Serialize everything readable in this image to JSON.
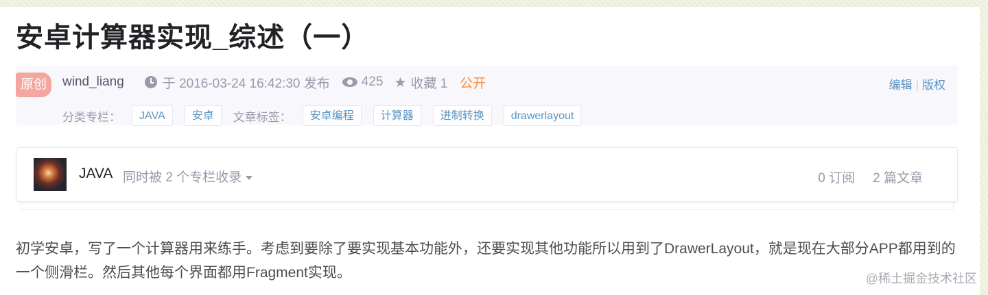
{
  "title": "安卓计算器实现_综述（一）",
  "meta": {
    "badge": "原创",
    "author": "wind_liang",
    "published": "于 2016-03-24 16:42:30 发布",
    "views": "425",
    "favorites": "收藏 1",
    "visibility": "公开",
    "edit_label": "编辑",
    "copyright_label": "版权",
    "category_label": "分类专栏：",
    "categories": [
      "JAVA",
      "安卓"
    ],
    "tags_label": "文章标签：",
    "tags": [
      "安卓编程",
      "计算器",
      "进制转换",
      "drawerlayout"
    ]
  },
  "column": {
    "name": "JAVA",
    "subtitle": "同时被 2 个专栏收录",
    "subscriptions": "0 订阅",
    "articles": "2 篇文章"
  },
  "article": {
    "paragraph": "初学安卓，写了一个计算器用来练手。考虑到要除了要实现基本功能外，还要实现其他功能所以用到了DrawerLayout，就是现在大部分APP都用到的一个侧滑栏。然后其他每个界面都用Fragment实现。"
  },
  "watermark": "@稀土掘金技术社区",
  "colors": {
    "link": "#5893c2",
    "public": "#fc8d3b",
    "badge": "#f3a79f"
  }
}
